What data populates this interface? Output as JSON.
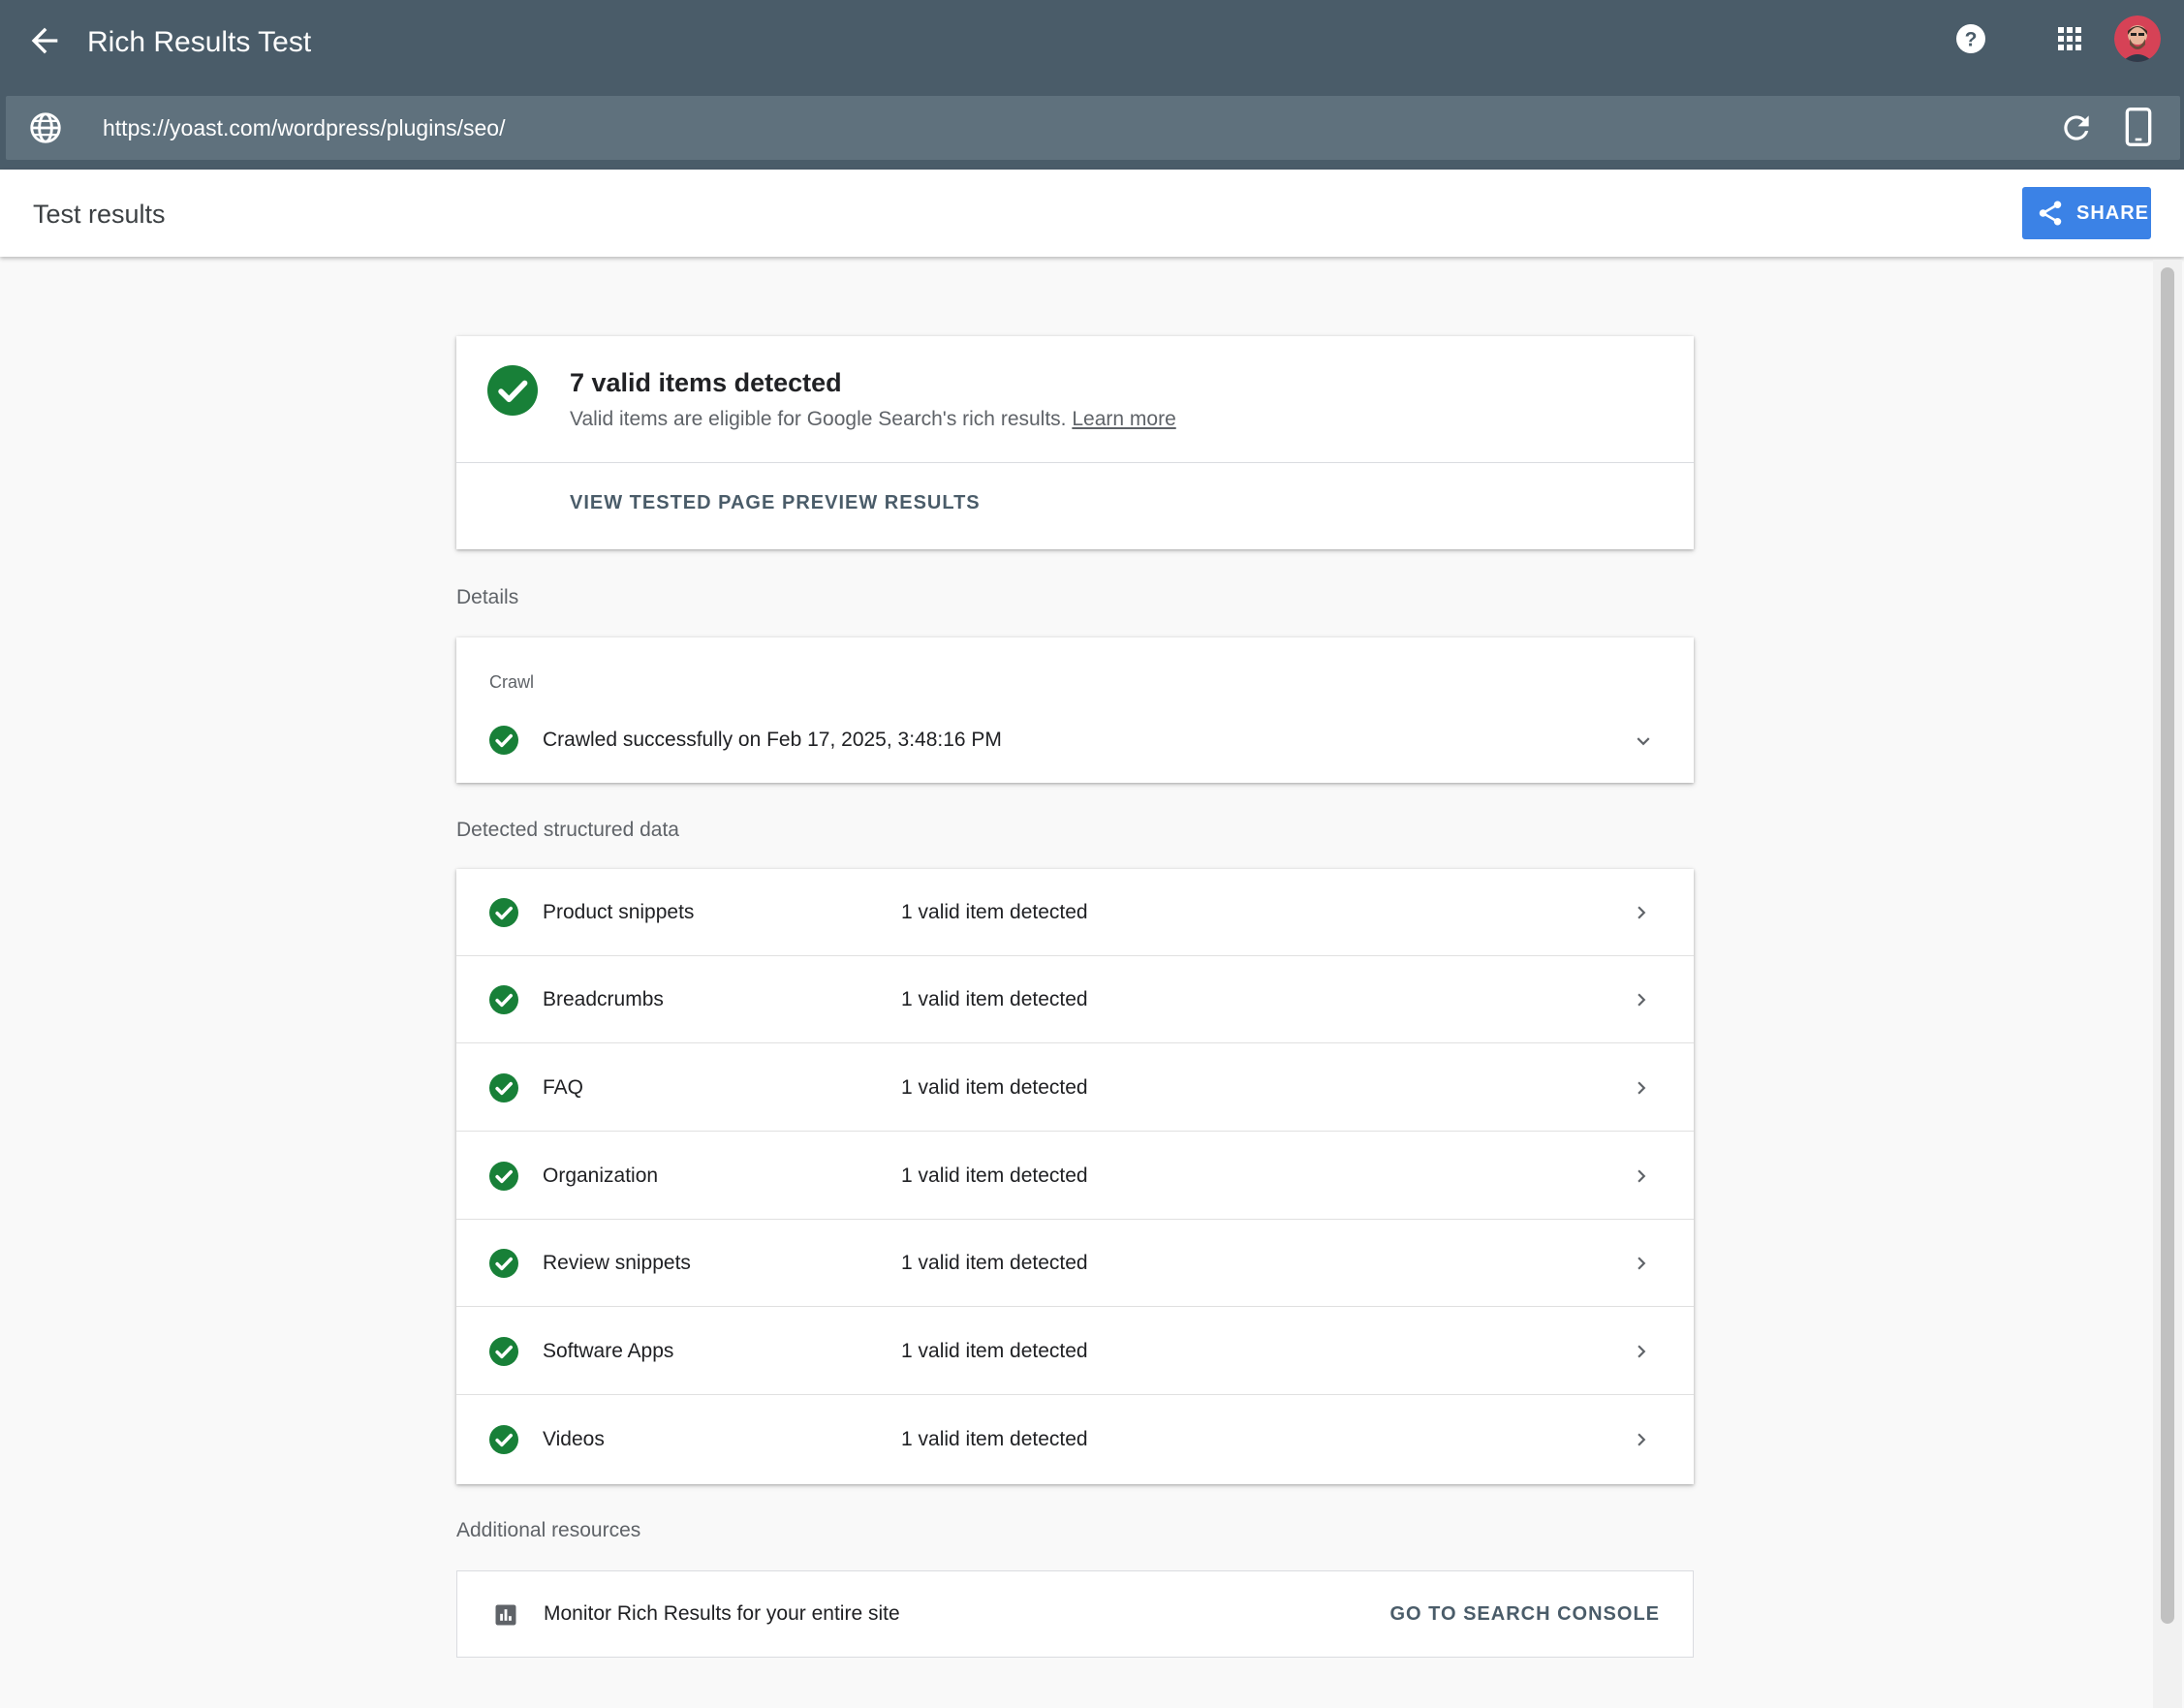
{
  "app": {
    "title": "Rich Results Test"
  },
  "url_bar": {
    "url": "https://yoast.com/wordpress/plugins/seo/"
  },
  "header": {
    "title": "Test results",
    "share_label": "SHARE"
  },
  "summary": {
    "title": "7 valid items detected",
    "subtitle": "Valid items are eligible for Google Search's rich results.",
    "learn_more": "Learn more",
    "actions": [
      "VIEW TESTED PAGE",
      "PREVIEW RESULTS"
    ]
  },
  "details": {
    "section_label": "Details",
    "crawl_label": "Crawl",
    "crawl_status": "Crawled successfully on Feb 17, 2025, 3:48:16 PM"
  },
  "structured": {
    "section_label": "Detected structured data",
    "items": [
      {
        "name": "Product snippets",
        "status": "1 valid item detected"
      },
      {
        "name": "Breadcrumbs",
        "status": "1 valid item detected"
      },
      {
        "name": "FAQ",
        "status": "1 valid item detected"
      },
      {
        "name": "Organization",
        "status": "1 valid item detected"
      },
      {
        "name": "Review snippets",
        "status": "1 valid item detected"
      },
      {
        "name": "Software Apps",
        "status": "1 valid item detected"
      },
      {
        "name": "Videos",
        "status": "1 valid item detected"
      }
    ]
  },
  "resources": {
    "section_label": "Additional resources",
    "text": "Monitor Rich Results for your entire site",
    "link": "GO TO SEARCH CONSOLE"
  },
  "colors": {
    "appbar": "#4a5c69",
    "success": "#188038",
    "share": "#3b82e6"
  },
  "icons": {
    "back": "arrow-left-icon",
    "help": "help-circle-icon",
    "apps": "apps-grid-icon",
    "globe": "globe-icon",
    "reload": "reload-icon",
    "device": "smartphone-icon",
    "share": "share-icon",
    "check": "check-circle-icon",
    "chevron": "chevron-right-icon",
    "expand": "chevron-down-icon",
    "chart": "bar-chart-icon"
  }
}
